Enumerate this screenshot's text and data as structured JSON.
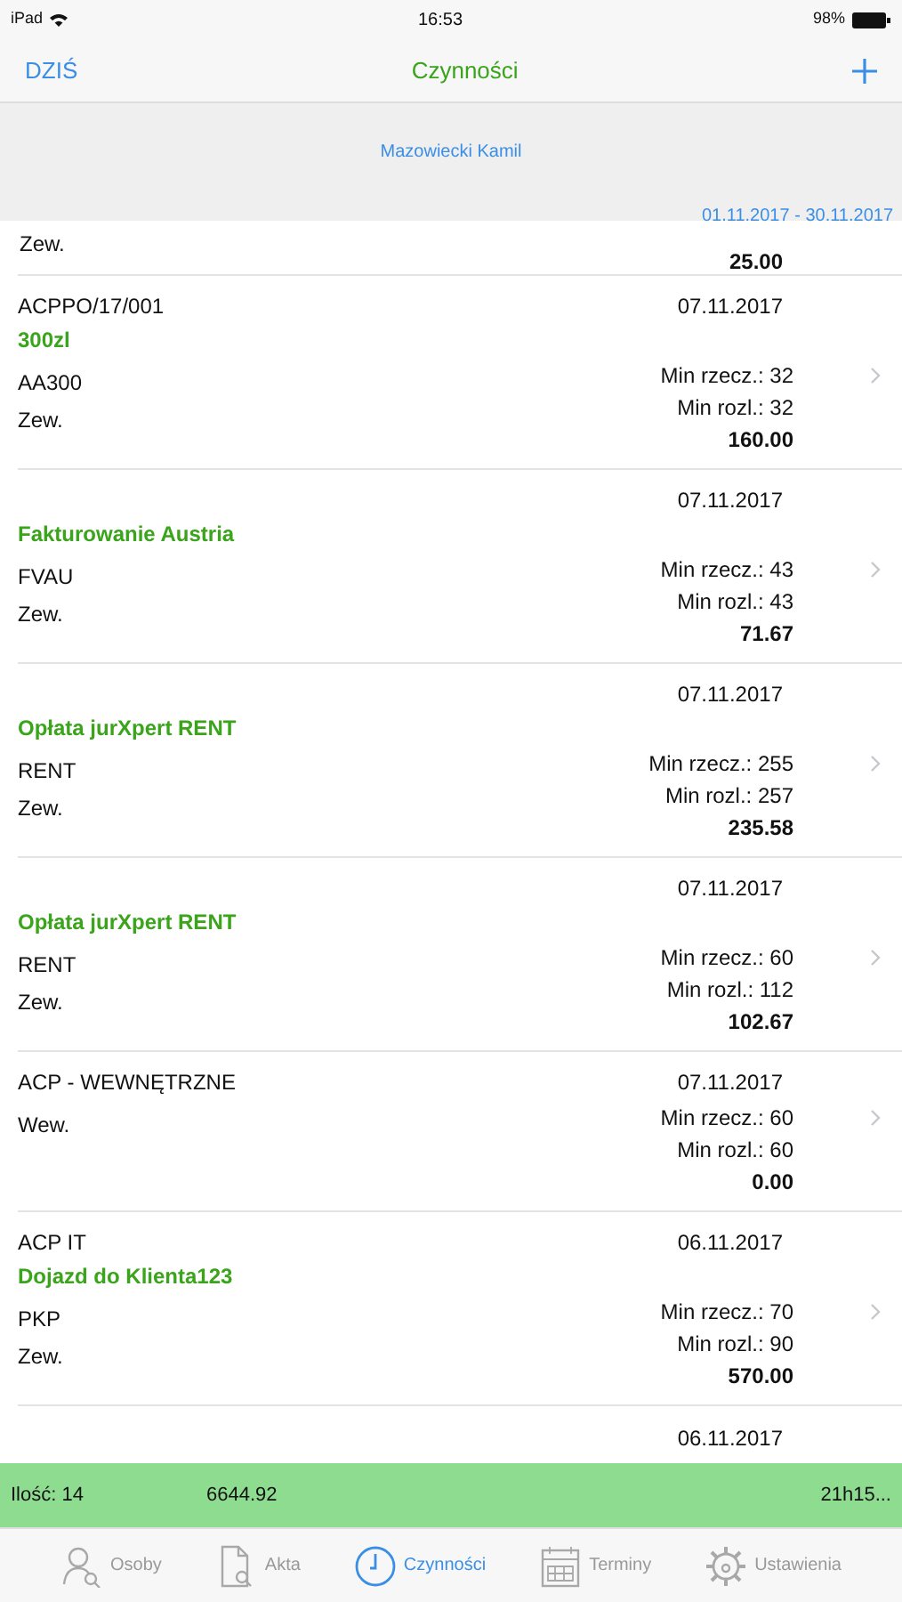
{
  "status_bar": {
    "device": "iPad",
    "time": "16:53",
    "battery": "98%"
  },
  "nav": {
    "left": "DZIŚ",
    "title": "Czynności"
  },
  "header": {
    "person": "Mazowiecki Kamil",
    "range": "01.11.2017 - 30.11.2017"
  },
  "rows": [
    {
      "kind": "partial_top",
      "lines": [
        "Zew."
      ],
      "amount": "25.00"
    },
    {
      "kind": "full",
      "code": "ACPPO/17/001",
      "date": "07.11.2017",
      "title": "300zl",
      "lines": [
        "AA300",
        "Zew."
      ],
      "min_rzecz": "Min rzecz.: 32",
      "min_rozl": "Min rozl.: 32",
      "amount": "160.00"
    },
    {
      "kind": "full",
      "date": "07.11.2017",
      "title": "Fakturowanie Austria",
      "lines": [
        "FVAU",
        "Zew."
      ],
      "min_rzecz": "Min rzecz.: 43",
      "min_rozl": "Min rozl.: 43",
      "amount": "71.67"
    },
    {
      "kind": "full",
      "date": "07.11.2017",
      "title": "Opłata jurXpert RENT",
      "lines": [
        "RENT",
        "Zew."
      ],
      "min_rzecz": "Min rzecz.: 255",
      "min_rozl": "Min rozl.: 257",
      "amount": "235.58"
    },
    {
      "kind": "full",
      "date": "07.11.2017",
      "title": "Opłata jurXpert RENT",
      "lines": [
        "RENT",
        "Zew."
      ],
      "min_rzecz": "Min rzecz.: 60",
      "min_rozl": "Min rozl.: 112",
      "amount": "102.67"
    },
    {
      "kind": "full",
      "code": "ACP - WEWNĘTRZNE",
      "date": "07.11.2017",
      "lines": [
        "Wew."
      ],
      "min_rzecz": "Min rzecz.: 60",
      "min_rozl": "Min rozl.: 60",
      "amount": "0.00"
    },
    {
      "kind": "full",
      "code": "ACP IT",
      "date": "06.11.2017",
      "title": "Dojazd do Klienta123",
      "lines": [
        "PKP",
        "Zew."
      ],
      "min_rzecz": "Min rzecz.: 70",
      "min_rozl": "Min rozl.: 90",
      "amount": "570.00"
    },
    {
      "kind": "partial_bottom",
      "date": "06.11.2017"
    }
  ],
  "summary": {
    "count": "Ilość: 14",
    "total": "6644.92",
    "time": "21h15..."
  },
  "tabs": [
    {
      "label": "Osoby",
      "selected": false
    },
    {
      "label": "Akta",
      "selected": false
    },
    {
      "label": "Czynności",
      "selected": true
    },
    {
      "label": "Terminy",
      "selected": false
    },
    {
      "label": "Ustawienia",
      "selected": false
    }
  ]
}
